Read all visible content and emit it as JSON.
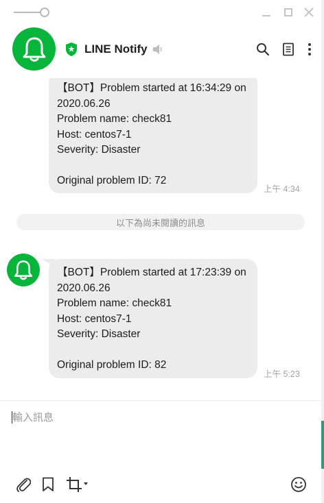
{
  "window": {
    "controls": [
      "minimize",
      "maximize",
      "close"
    ]
  },
  "header": {
    "title": "LINE Notify",
    "avatar_icon": "bell-icon",
    "verified_icon": "shield-star-icon",
    "muted_icon": "speaker-muted-icon",
    "actions": [
      "search-icon",
      "notes-icon",
      "more-icon"
    ],
    "brand_color": "#07b53b"
  },
  "messages": [
    {
      "lines": [
        "【BOT】Problem started at 16:34:29 on",
        "2020.06.26",
        "Problem name: check81",
        "Host: centos7-1",
        "Severity: Disaster",
        "",
        "Original problem ID: 72"
      ],
      "time": "上午 4:34"
    },
    {
      "lines": [
        "【BOT】Problem started at 17:23:39 on",
        "2020.06.26",
        "Problem name: check81",
        "Host: centos7-1",
        "Severity: Disaster",
        "",
        "Original problem ID: 82"
      ],
      "time": "上午 5:23"
    }
  ],
  "unread_divider": "以下為尚未閱讀的訊息",
  "composer": {
    "placeholder": "輸入訊息",
    "value": "",
    "tools": [
      "paperclip-icon",
      "bookmark-icon",
      "crop-icon",
      "emoji-icon"
    ]
  }
}
